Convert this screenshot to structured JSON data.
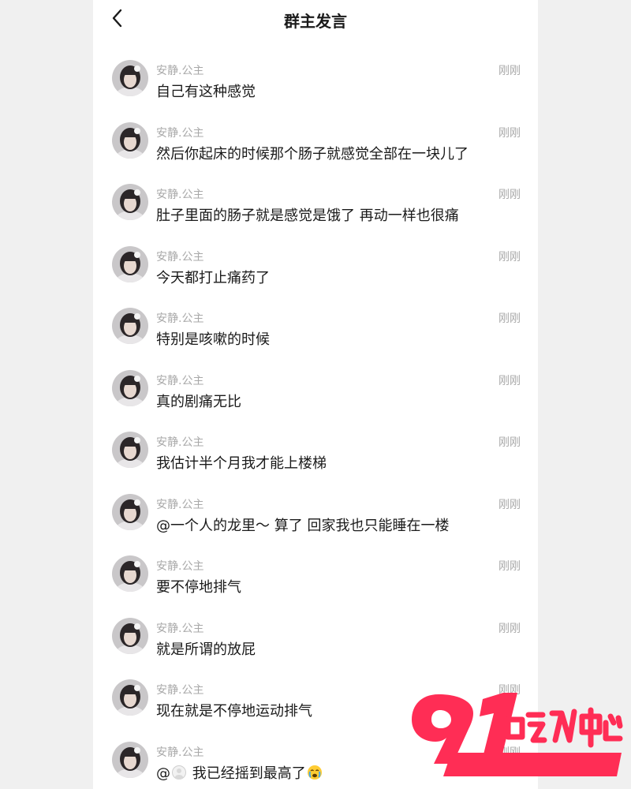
{
  "header": {
    "title": "群主发言",
    "back_icon": "chevron-left-icon"
  },
  "messages": [
    {
      "sender": "安静.公主",
      "time": "刚刚",
      "text": "自己有这种感觉"
    },
    {
      "sender": "安静.公主",
      "time": "刚刚",
      "text": "然后你起床的时候那个肠子就感觉全部在一块儿了"
    },
    {
      "sender": "安静.公主",
      "time": "刚刚",
      "text": "肚子里面的肠子就是感觉是饿了 再动一样也很痛"
    },
    {
      "sender": "安静.公主",
      "time": "刚刚",
      "text": "今天都打止痛药了"
    },
    {
      "sender": "安静.公主",
      "time": "刚刚",
      "text": "特别是咳嗽的时候"
    },
    {
      "sender": "安静.公主",
      "time": "刚刚",
      "text": "真的剧痛无比"
    },
    {
      "sender": "安静.公主",
      "time": "刚刚",
      "text": "我估计半个月我才能上楼梯"
    },
    {
      "sender": "安静.公主",
      "time": "刚刚",
      "text": "@一个人的龙里～ 算了 回家我也只能睡在一楼"
    },
    {
      "sender": "安静.公主",
      "time": "刚刚",
      "text": "要不停地排气"
    },
    {
      "sender": "安静.公主",
      "time": "刚刚",
      "text": "就是所谓的放屁"
    },
    {
      "sender": "安静.公主",
      "time": "刚刚",
      "text": "现在就是不停地运动排气"
    },
    {
      "sender": "安静.公主",
      "time": "刚刚",
      "text_before": "@",
      "text_after": " 我已经摇到最高了",
      "inline_icons": [
        "mention-avatar-icon",
        "crying-emoji-icon"
      ]
    }
  ],
  "watermark": {
    "brand": "91吃瓜中心",
    "url": "https://91chigua20.com",
    "color": "#ff2d55"
  }
}
